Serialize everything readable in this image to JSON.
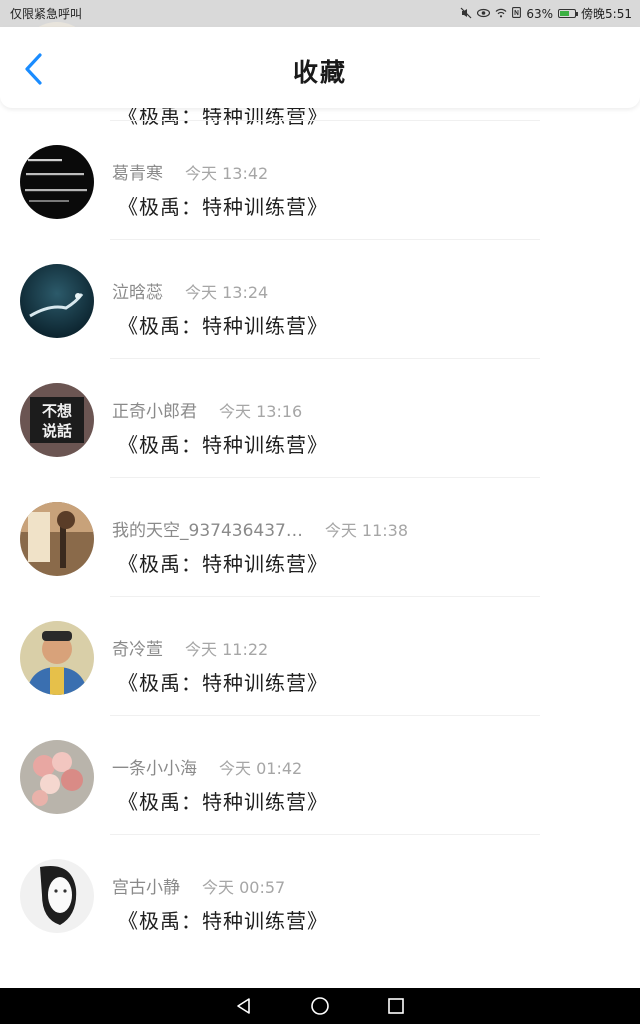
{
  "status_bar": {
    "left_text": "仅限紧急呼叫",
    "battery_text": "63%",
    "battery_level": 0.63,
    "time_text": "傍晚5:51",
    "icons": [
      "mute-icon",
      "eye-icon",
      "wifi-icon",
      "nfc-icon",
      "battery-icon"
    ]
  },
  "header": {
    "title": "收藏",
    "back_icon": "chevron-left-icon"
  },
  "items": [
    {
      "name": "",
      "time": "",
      "title": "《极禹：特种训练营》"
    },
    {
      "name": "葛青寒",
      "time": "今天 13:42",
      "title": "《极禹：特种训练营》"
    },
    {
      "name": "泣晗蕊",
      "time": "今天 13:24",
      "title": "《极禹：特种训练营》"
    },
    {
      "name": "正奇小郎君",
      "time": "今天 13:16",
      "title": "《极禹：特种训练营》",
      "avatar_text": "不想说話"
    },
    {
      "name": "我的天空_937436437…",
      "time": "今天 11:38",
      "title": "《极禹：特种训练营》"
    },
    {
      "name": "奇冷萱",
      "time": "今天 11:22",
      "title": "《极禹：特种训练营》"
    },
    {
      "name": "一条小小海",
      "time": "今天 01:42",
      "title": "《极禹：特种训练营》"
    },
    {
      "name": "宫古小静",
      "time": "今天 00:57",
      "title": "《极禹：特种训练营》"
    }
  ],
  "nav": {
    "back_icon": "triangle-back-icon",
    "home_icon": "circle-home-icon",
    "recent_icon": "square-recents-icon"
  },
  "colors": {
    "accent": "#1a8cff",
    "status_bar_bg": "#d9d9d9",
    "nav_bar_bg": "#000000"
  }
}
